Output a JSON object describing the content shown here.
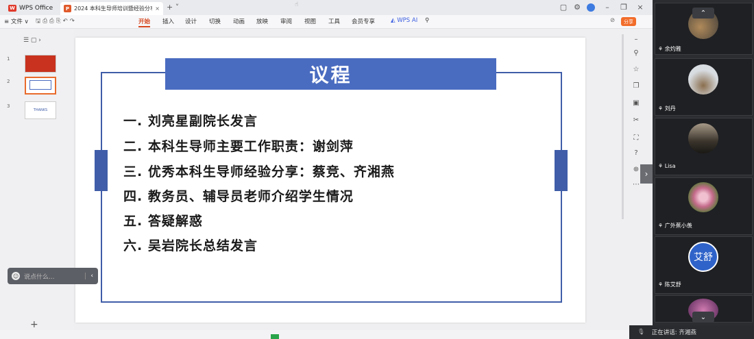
{
  "app": {
    "name": "WPS Office",
    "doc_tab": "2024 本科生导师培训暨经验分享"
  },
  "menubar": {
    "file": "≡ 文件 ∨",
    "items": [
      "开始",
      "插入",
      "设计",
      "切换",
      "动画",
      "放映",
      "审阅",
      "视图",
      "工具",
      "会员专享"
    ],
    "ai": "WPS AI",
    "share": "分享"
  },
  "thumbs": {
    "nums": [
      "1",
      "2",
      "3"
    ],
    "thumb3_text": "THANKS"
  },
  "slide": {
    "title": "议程",
    "items": [
      "一. 刘亮星副院长发言",
      "二. 本科生导师主要工作职责：谢剑萍",
      "三. 优秀本科生导师经验分享：蔡竞、齐湘燕",
      "四. 教务员、辅导员老师介绍学生情况",
      "五. 答疑解惑",
      "六. 吴岩院长总结发言"
    ]
  },
  "chat": {
    "placeholder": "说点什么..."
  },
  "participants": [
    {
      "name": "余灼雅"
    },
    {
      "name": "刘丹"
    },
    {
      "name": "Lisa"
    },
    {
      "name": "广外蕉小羡"
    },
    {
      "name": "陈艾舒",
      "avatar_text": "艾舒"
    }
  ],
  "speaking": {
    "label": "正在讲话: 齐湘燕"
  },
  "colors": {
    "accent": "#4a6cc0",
    "frame": "#3f5da8",
    "wps": "#e0392b"
  }
}
